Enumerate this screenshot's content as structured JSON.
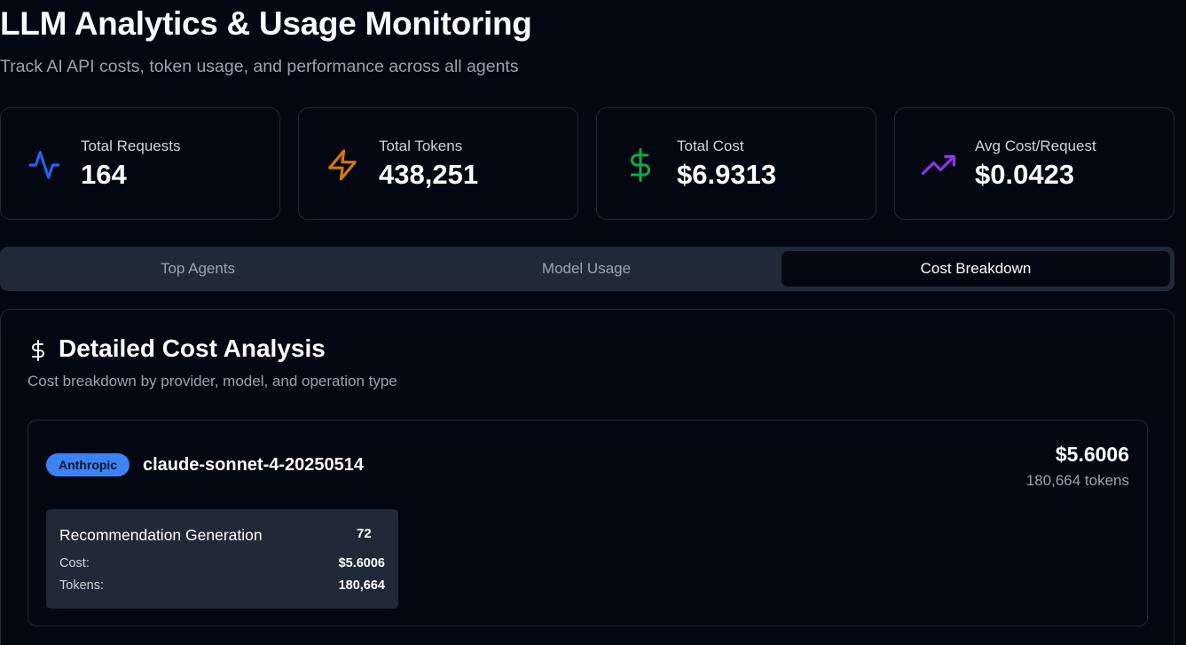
{
  "header": {
    "title": "LLM Analytics & Usage Monitoring",
    "subtitle": "Track AI API costs, token usage, and performance across all agents"
  },
  "stats": [
    {
      "label": "Total Requests",
      "value": "164",
      "icon": "activity-icon",
      "color": "#2563eb"
    },
    {
      "label": "Total Tokens",
      "value": "438,251",
      "icon": "zap-icon",
      "color": "#d97706"
    },
    {
      "label": "Total Cost",
      "value": "$6.9313",
      "icon": "dollar-icon",
      "color": "#16a34a"
    },
    {
      "label": "Avg Cost/Request",
      "value": "$0.0423",
      "icon": "trending-up-icon",
      "color": "#9333ea"
    }
  ],
  "tabs": [
    {
      "label": "Top Agents",
      "active": false
    },
    {
      "label": "Model Usage",
      "active": false
    },
    {
      "label": "Cost Breakdown",
      "active": true
    }
  ],
  "panel": {
    "icon": "dollar-icon",
    "title": "Detailed Cost Analysis",
    "subtitle": "Cost breakdown by provider, model, and operation type"
  },
  "model": {
    "provider": "Anthropic",
    "provider_color": "#3b82f6",
    "name": "claude-sonnet-4-20250514",
    "cost": "$5.6006",
    "tokens": "180,664 tokens",
    "operation": {
      "name": "Recommendation Generation",
      "count": "72",
      "cost_label": "Cost:",
      "cost_value": "$5.6006",
      "tokens_label": "Tokens:",
      "tokens_value": "180,664"
    }
  }
}
